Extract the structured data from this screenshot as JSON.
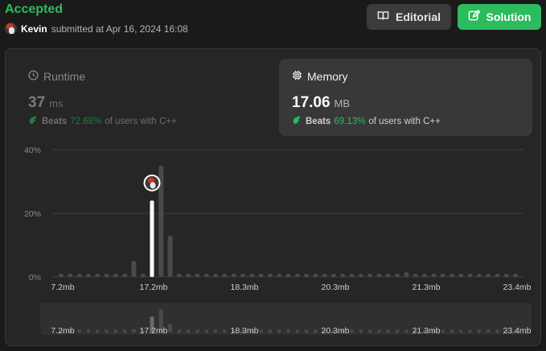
{
  "submission": {
    "status": "Accepted",
    "user": "Kevin",
    "submitted_text": "submitted at Apr 16, 2024 16:08"
  },
  "actions": {
    "editorial_label": "Editorial",
    "solution_label": "Solution"
  },
  "runtime": {
    "label": "Runtime",
    "value": "37",
    "unit": "ms",
    "beats_word": "Beats",
    "beats_pct": "72.68%",
    "beats_suffix": "of users with C++"
  },
  "memory": {
    "label": "Memory",
    "value": "17.06",
    "unit": "MB",
    "beats_word": "Beats",
    "beats_pct": "69.13%",
    "beats_suffix": "of users with C++"
  },
  "colors": {
    "accepted": "#2cbb5d",
    "panel": "#262626",
    "active_card": "#383838",
    "bar": "#4a4a4a",
    "highlight_bar": "#ffffff"
  },
  "chart_data": {
    "type": "bar",
    "y_ticks": [
      "40%",
      "20%",
      "0%"
    ],
    "y_tick_values": [
      40,
      20,
      0
    ],
    "ylim": [
      0,
      40
    ],
    "x_ticks": [
      "7.2mb",
      "17.2mb",
      "18.3mb",
      "20.3mb",
      "21.3mb",
      "23.4mb"
    ],
    "x_tick_indices": [
      0,
      10,
      20,
      30,
      40,
      50
    ],
    "bin_count": 51,
    "values": [
      1,
      1,
      1,
      1,
      1,
      1,
      1,
      1,
      5,
      1,
      24,
      35,
      13,
      1,
      1,
      1,
      1,
      1,
      1,
      1,
      1,
      1,
      1,
      1,
      1,
      1,
      1,
      1,
      1,
      1,
      1,
      1,
      1,
      1,
      1,
      1,
      1,
      1,
      1.5,
      1,
      1,
      1,
      1,
      1,
      1,
      1,
      1,
      1,
      1,
      1,
      1
    ],
    "highlight_index": 10,
    "highlight_marker": "user-avatar",
    "grid": true
  },
  "overview": {
    "x_ticks": [
      "7.2mb",
      "17.2mb",
      "18.3mb",
      "20.3mb",
      "21.3mb",
      "23.4mb"
    ]
  }
}
